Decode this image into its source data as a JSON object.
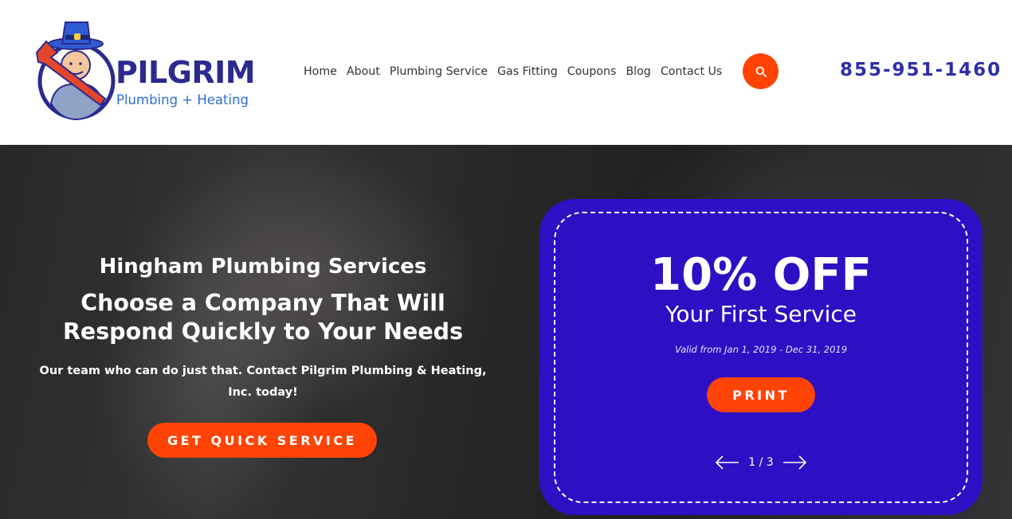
{
  "header": {
    "logo": {
      "name": "PILGRIM",
      "tagline": "Plumbing + Heating",
      "icon": "plumber-mascot-icon"
    },
    "nav": [
      {
        "label": "Home"
      },
      {
        "label": "About"
      },
      {
        "label": "Plumbing Service"
      },
      {
        "label": "Gas Fitting"
      },
      {
        "label": "Coupons"
      },
      {
        "label": "Blog"
      },
      {
        "label": "Contact Us"
      }
    ],
    "search_icon": "search-icon",
    "phone": "855-951-1460"
  },
  "hero": {
    "kicker": "Hingham Plumbing Services",
    "title": "Choose a Company That Will Respond Quickly to Your Needs",
    "description": "Our team who can do just that. Contact Pilgrim Plumbing & Heating, Inc. today!",
    "cta_label": "GET QUICK SERVICE"
  },
  "coupon": {
    "amount": "10% OFF",
    "subtitle": "Your First Service",
    "validity": "Valid from Jan 1, 2019 - Dec 31, 2019",
    "print_label": "PRINT",
    "pager": "1 / 3",
    "prev_icon": "arrow-left-icon",
    "next_icon": "arrow-right-icon"
  },
  "colors": {
    "brand_blue": "#2b2a8f",
    "accent_orange": "#ff4406",
    "coupon_purple": "#2e0fc4",
    "tagline_blue": "#2d6fd1"
  }
}
